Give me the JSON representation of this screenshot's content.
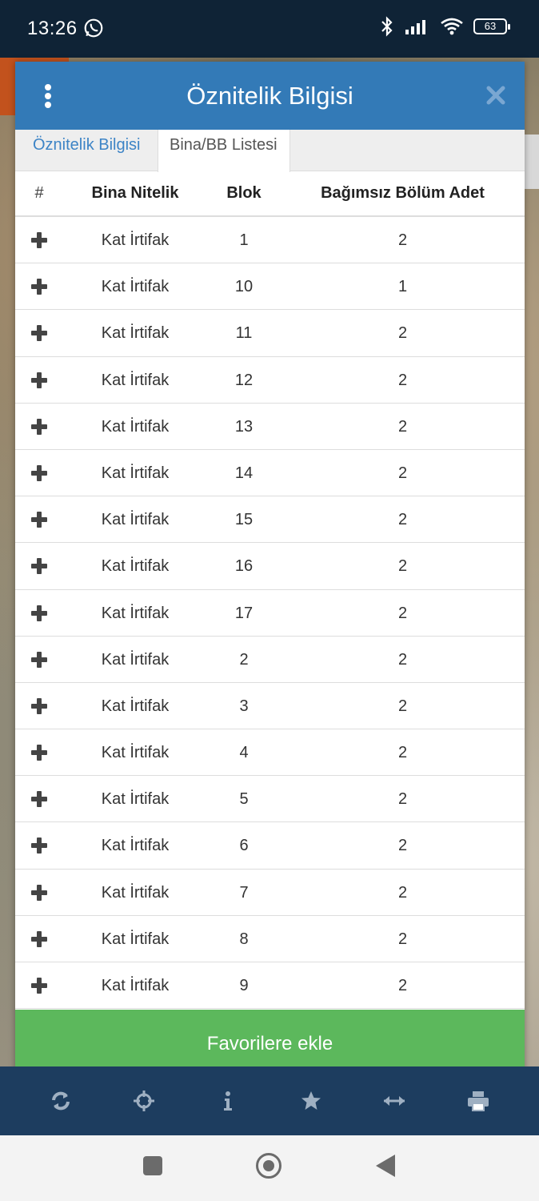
{
  "status_bar": {
    "time": "13:26",
    "battery": "63"
  },
  "dialog": {
    "title": "Öznitelik Bilgisi",
    "tabs": [
      {
        "label": "Öznitelik Bilgisi",
        "active": false
      },
      {
        "label": "Bina/BB Listesi",
        "active": true
      }
    ],
    "table": {
      "headers": [
        "#",
        "Bina Nitelik",
        "Blok",
        "Bağımsız Bölüm Adet"
      ],
      "rows": [
        {
          "nitelik": "Kat İrtifak",
          "blok": "1",
          "adet": "2"
        },
        {
          "nitelik": "Kat İrtifak",
          "blok": "10",
          "adet": "1"
        },
        {
          "nitelik": "Kat İrtifak",
          "blok": "11",
          "adet": "2"
        },
        {
          "nitelik": "Kat İrtifak",
          "blok": "12",
          "adet": "2"
        },
        {
          "nitelik": "Kat İrtifak",
          "blok": "13",
          "adet": "2"
        },
        {
          "nitelik": "Kat İrtifak",
          "blok": "14",
          "adet": "2"
        },
        {
          "nitelik": "Kat İrtifak",
          "blok": "15",
          "adet": "2"
        },
        {
          "nitelik": "Kat İrtifak",
          "blok": "16",
          "adet": "2"
        },
        {
          "nitelik": "Kat İrtifak",
          "blok": "17",
          "adet": "2"
        },
        {
          "nitelik": "Kat İrtifak",
          "blok": "2",
          "adet": "2"
        },
        {
          "nitelik": "Kat İrtifak",
          "blok": "3",
          "adet": "2"
        },
        {
          "nitelik": "Kat İrtifak",
          "blok": "4",
          "adet": "2"
        },
        {
          "nitelik": "Kat İrtifak",
          "blok": "5",
          "adet": "2"
        },
        {
          "nitelik": "Kat İrtifak",
          "blok": "6",
          "adet": "2"
        },
        {
          "nitelik": "Kat İrtifak",
          "blok": "7",
          "adet": "2"
        },
        {
          "nitelik": "Kat İrtifak",
          "blok": "8",
          "adet": "2"
        },
        {
          "nitelik": "Kat İrtifak",
          "blok": "9",
          "adet": "2"
        }
      ]
    },
    "favorite_button": "Favorilere ekle"
  },
  "toolbar": {
    "icons": [
      "refresh-icon",
      "crosshair-icon",
      "info-icon",
      "star-icon",
      "measure-icon",
      "print-icon"
    ]
  },
  "colors": {
    "header_blue": "#337ab7",
    "button_green": "#5cb85c",
    "toolbar_navy": "#1d3d5f",
    "tab_link_blue": "#3d84c6"
  }
}
